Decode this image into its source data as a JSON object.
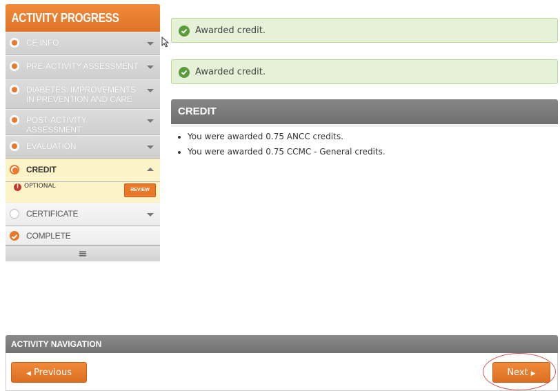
{
  "sidebar": {
    "title": "ACTIVITY PROGRESS",
    "items": [
      {
        "label": "CE INFO"
      },
      {
        "label": "PRE-ACTIVITY ASSESSMENT"
      },
      {
        "label": "DIABETES: IMPROVEMENTS IN PREVENTION AND CARE"
      },
      {
        "label": "POST-ACTIVITY ASSESSMENT"
      },
      {
        "label": "EVALUATION"
      },
      {
        "label": "CREDIT",
        "status": "OPTIONAL",
        "action": "REVIEW"
      },
      {
        "label": "CERTIFICATE"
      },
      {
        "label": "COMPLETE"
      }
    ],
    "footer_icon": "≡"
  },
  "alerts": [
    {
      "text": "Awarded credit."
    },
    {
      "text": "Awarded credit."
    }
  ],
  "credit": {
    "title": "CREDIT",
    "items": [
      "You were awarded 0.75 ANCC credits.",
      "You were awarded 0.75 CCMC - General credits."
    ]
  },
  "navigation": {
    "title": "ACTIVITY NAVIGATION",
    "previous_label": "Previous",
    "next_label": "Next"
  },
  "colors": {
    "accent": "#e8782a",
    "success": "#5a9b3b",
    "highlight": "#d9534f"
  }
}
